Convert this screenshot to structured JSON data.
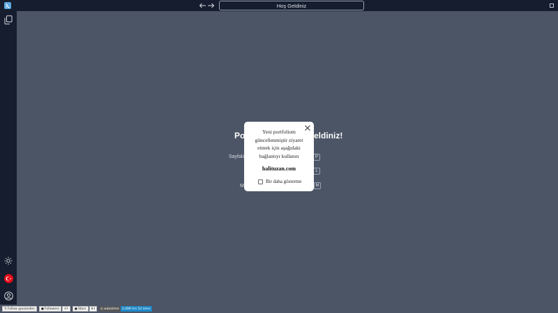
{
  "window": {
    "title": "Hoş Geldiniz",
    "logo_icon": "app-logo-icon"
  },
  "sidebar": {
    "items": [
      {
        "name": "explorer",
        "icon": "copy-files-icon"
      },
      {
        "name": "theme",
        "icon": "sun-icon"
      },
      {
        "name": "language",
        "icon": "turkey-flag-icon"
      },
      {
        "name": "account",
        "icon": "user-circle-icon"
      }
    ]
  },
  "main": {
    "title_left": "Po",
    "title_right": "eldiniz!",
    "hints": [
      {
        "label": "Sayfala",
        "key": "P"
      },
      {
        "label": "",
        "key": "L"
      },
      {
        "label": "M",
        "key": "M"
      }
    ]
  },
  "modal": {
    "message": "Yeni portfoliom güncellenmiştir ziyaret etmek için aşağıdaki bağlantıyı kullanın",
    "link": "halituzan.com",
    "checkbox_label": "Bir daha gösterme",
    "checked": false
  },
  "statusbar": {
    "twitter": "Follow @uzandev",
    "followers_label": "Followers",
    "followers_count": "43",
    "stars_label": "Stars",
    "stars_count": "83",
    "wakatime_label": "wakatime",
    "wakatime_value": "2,496 hrs 52 mins"
  },
  "colors": {
    "background": "#4c5566",
    "sidebar": "#151d2e",
    "wakatime_blue": "#1e88c7"
  }
}
